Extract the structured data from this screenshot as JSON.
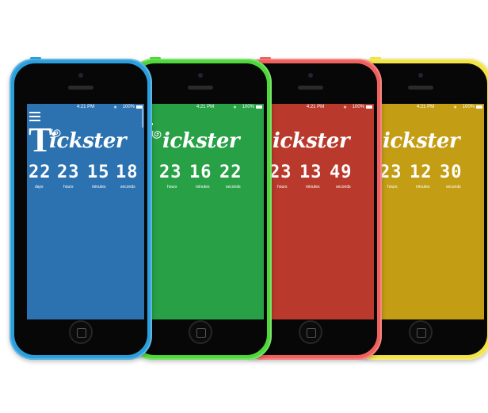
{
  "phones": [
    {
      "body_color": "#2b9fdb",
      "screen_color": "#2c72b0",
      "status": {
        "time": "4:21 PM",
        "battery": "100%"
      },
      "brand": {
        "initial": "T",
        "word": "ickster"
      },
      "countdown": {
        "days": "22",
        "hours": "23",
        "minutes": "15",
        "seconds": "18"
      },
      "units": {
        "days": "days",
        "hours": "hours",
        "minutes": "minutes",
        "seconds": "seconds"
      }
    },
    {
      "body_color": "#4fd83a",
      "screen_color": "#27a046",
      "status": {
        "time": "4:21 PM",
        "battery": "100%"
      },
      "brand": {
        "initial": "",
        "word": "ickster"
      },
      "countdown": {
        "days": "",
        "hours": "23",
        "minutes": "16",
        "seconds": "22"
      },
      "units": {
        "days": "",
        "hours": "hours",
        "minutes": "minutes",
        "seconds": "seconds"
      }
    },
    {
      "body_color": "#f0605d",
      "screen_color": "#b93a2c",
      "status": {
        "time": "4:21 PM",
        "battery": "100%"
      },
      "brand": {
        "initial": "",
        "word": "ickster"
      },
      "countdown": {
        "days": "",
        "hours": "23",
        "minutes": "13",
        "seconds": "49"
      },
      "units": {
        "days": "",
        "hours": "hours",
        "minutes": "minutes",
        "seconds": "seconds"
      }
    },
    {
      "body_color": "#f2e347",
      "screen_color": "#c39d14",
      "status": {
        "time": "4:21 PM",
        "battery": "100%"
      },
      "brand": {
        "initial": "",
        "word": "ickster"
      },
      "countdown": {
        "days": "",
        "hours": "23",
        "minutes": "12",
        "seconds": "30"
      },
      "units": {
        "days": "",
        "hours": "hours",
        "minutes": "minutes",
        "seconds": "seconds"
      }
    }
  ],
  "icons": {
    "menu": "menu-icon",
    "logo_swirl": "swirl-icon",
    "bluetooth": "bluetooth-icon",
    "battery": "battery-icon"
  }
}
